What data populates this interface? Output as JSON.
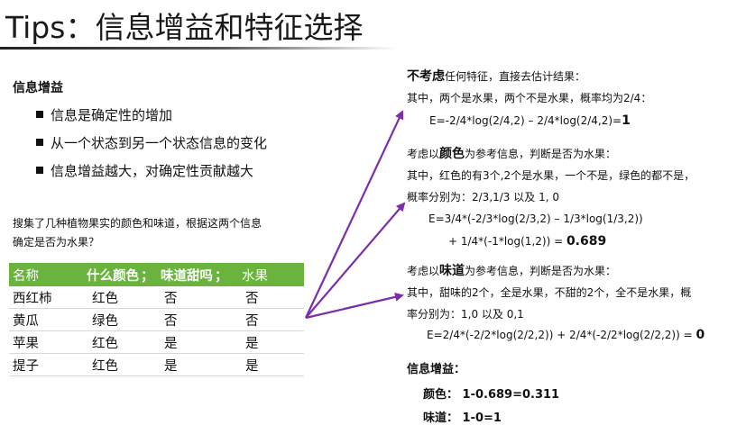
{
  "slide": {
    "title": "Tips：信息增益和特征选择"
  },
  "left": {
    "heading": "信息增益",
    "bullets": [
      "信息是确定性的增加",
      "从一个状态到另一个状态信息的变化",
      "信息增益越大，对确定性贡献越大"
    ],
    "question_line1": "搜集了几种植物果实的颜色和味道，根据这两个信息",
    "question_line2": "确定是否为水果？"
  },
  "table": {
    "headers": [
      "名称",
      "什么颜色",
      "味道甜吗",
      "水果"
    ],
    "header_sep": "；",
    "rows": [
      [
        "西红柿",
        "红色",
        "否",
        "否"
      ],
      [
        "黄瓜",
        "绿色",
        "否",
        "否"
      ],
      [
        "苹果",
        "红色",
        "是",
        "是"
      ],
      [
        "提子",
        "红色",
        "是",
        "是"
      ]
    ],
    "header_color": "#6ab43e"
  },
  "right": {
    "b1": {
      "lead_bold": "不考虑",
      "lead_rest": "任何特征，直接去估计结果：",
      "line2": "其中，两个是水果，两个不是水果，概率均为2/4：",
      "formula": "E=-2/4*log(2/4,2) – 2/4*log(2/4,2)=",
      "result": "1"
    },
    "b2": {
      "lead_pre": "考虑以",
      "lead_bold": "颜色",
      "lead_post": "为参考信息，判断是否为水果：",
      "line2": "其中，红色的有3个,2个是水果，一个不是，绿色的都不是，",
      "line3": "概率分别为：2/3,1/3  以及 1, 0",
      "formula1": "E=3/4*(-2/3*log(2/3,2) – 1/3*log(1/3,2))",
      "formula2": "+ 1/4*(-1*log(1,2)) = ",
      "result": "0.689"
    },
    "b3": {
      "lead_pre": "考虑以",
      "lead_bold": "味道",
      "lead_post": "为参考信息，判断是否为水果：",
      "line2": "其中，甜味的2个，全是水果，不甜的2个，全不是水果，概",
      "line3": "率分别为：1,0  以及 0,1",
      "formula": "E=2/4*(-2/2*log(2/2,2)) + 2/4*(-2/2*log(2/2,2)) = ",
      "result": "0"
    },
    "gain": {
      "heading": "信息增益：",
      "color_line": "颜色： 1-0.689=0.311",
      "taste_line": "味道： 1-0=1"
    }
  },
  "arrow_color": "#7b2fa8"
}
